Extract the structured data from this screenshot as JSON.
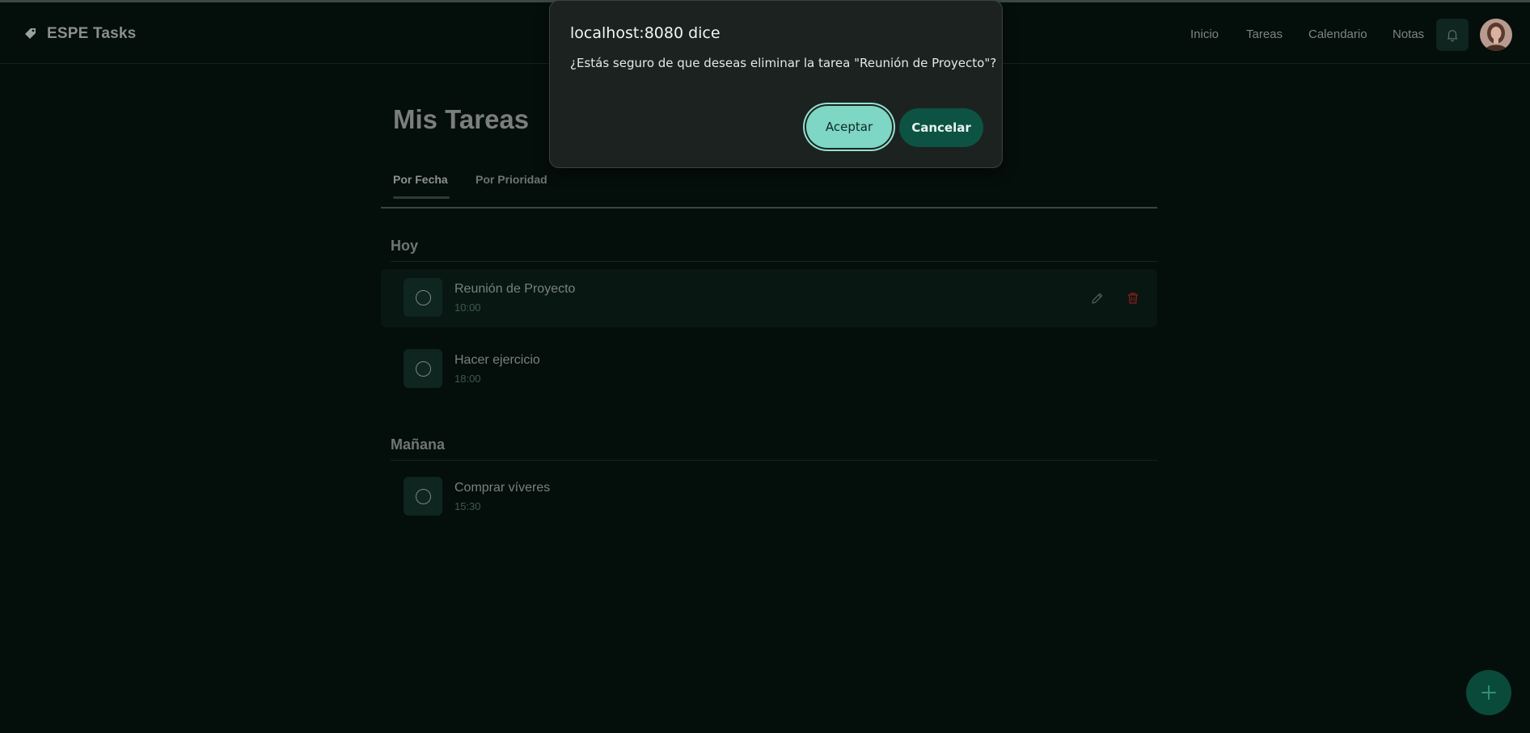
{
  "header": {
    "app_title": "ESPE Tasks",
    "logo_icon": "tag-icon",
    "nav": [
      "Inicio",
      "Tareas",
      "Calendario",
      "Notas"
    ],
    "bell_icon": "bell-icon",
    "avatar_icon": "user-avatar"
  },
  "main": {
    "title": "Mis Tareas",
    "tabs": [
      "Por Fecha",
      "Por Prioridad"
    ],
    "active_tab": "Por Fecha",
    "sections": [
      {
        "title": "Hoy",
        "tasks": [
          {
            "title": "Reunión de Proyecto",
            "time": "10:00"
          },
          {
            "title": "Hacer ejercicio",
            "time": "18:00"
          }
        ]
      },
      {
        "title": "Mañana",
        "tasks": [
          {
            "title": "Comprar víveres",
            "time": "15:30"
          }
        ]
      }
    ]
  },
  "fab": {
    "icon": "plus-icon"
  },
  "dialog": {
    "title": "localhost:8080 dice",
    "message": "¿Estás seguro de que deseas eliminar la tarea \"Reunión de Proyecto\"?",
    "accept_label": "Aceptar",
    "cancel_label": "Cancelar"
  },
  "colors": {
    "background": "#040e0b",
    "accent": "#7ed6c4",
    "accent_dark": "#0c5343",
    "delete": "#8b1d1d"
  }
}
